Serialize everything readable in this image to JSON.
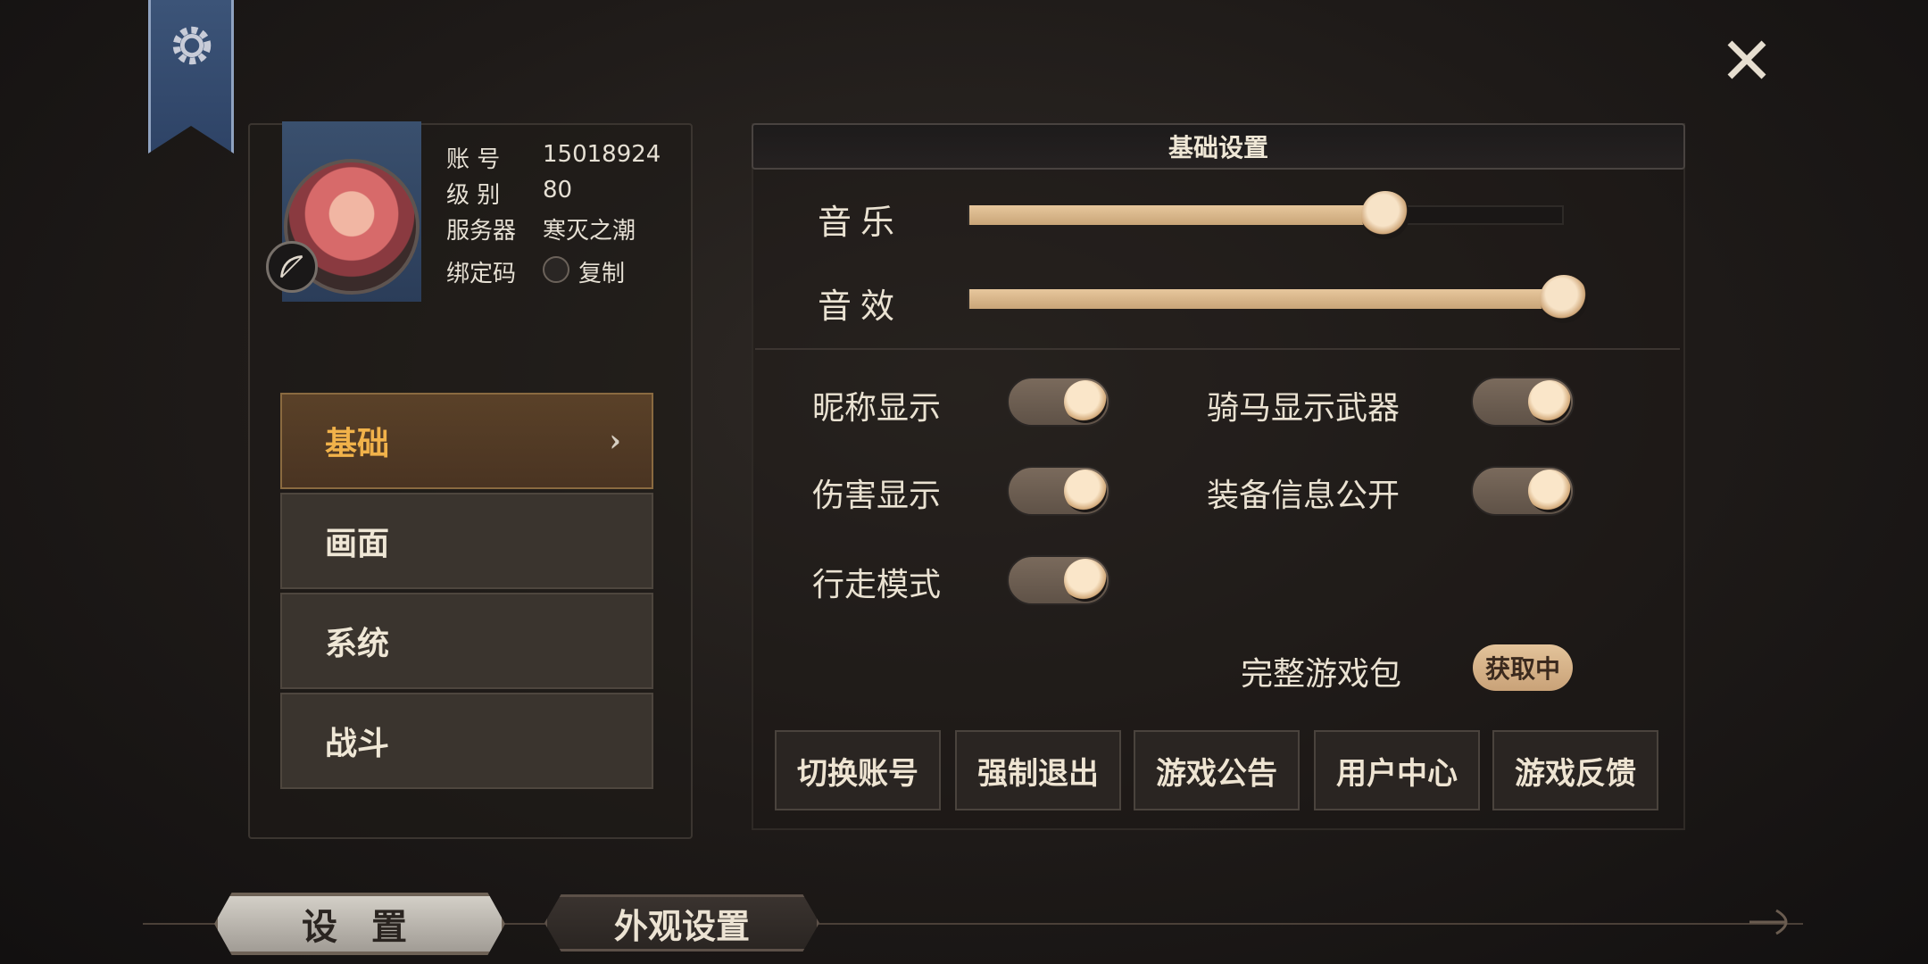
{
  "profile": {
    "account_label": "账 号",
    "account_value": "15018924",
    "level_label": "级 别",
    "level_value": "80",
    "server_label": "服务器",
    "server_value": "寒灭之潮",
    "bind_label": "绑定码",
    "copy_label": "复制"
  },
  "menu": [
    {
      "label": "基础",
      "active": true
    },
    {
      "label": "画面",
      "active": false
    },
    {
      "label": "系统",
      "active": false
    },
    {
      "label": "战斗",
      "active": false
    }
  ],
  "panel": {
    "title": "基础设置",
    "sliders": [
      {
        "label": "音乐",
        "value": 0.7
      },
      {
        "label": "音效",
        "value": 1.0
      }
    ],
    "toggles": [
      {
        "label": "昵称显示",
        "on": true
      },
      {
        "label": "骑马显示武器",
        "on": true
      },
      {
        "label": "伤害显示",
        "on": true
      },
      {
        "label": "装备信息公开",
        "on": true
      },
      {
        "label": "行走模式",
        "on": true
      }
    ],
    "package_label": "完整游戏包",
    "package_status": "获取中",
    "buttons": [
      "切换账号",
      "强制退出",
      "游戏公告",
      "用户中心",
      "游戏反馈"
    ]
  },
  "bottom_tabs": [
    {
      "label": "设 置",
      "active": true
    },
    {
      "label": "外观设置",
      "active": false
    }
  ],
  "colors": {
    "accent_gold": "#f1b24a",
    "banner_blue": "#3c5478",
    "slider_fill": "#e7c79d"
  }
}
